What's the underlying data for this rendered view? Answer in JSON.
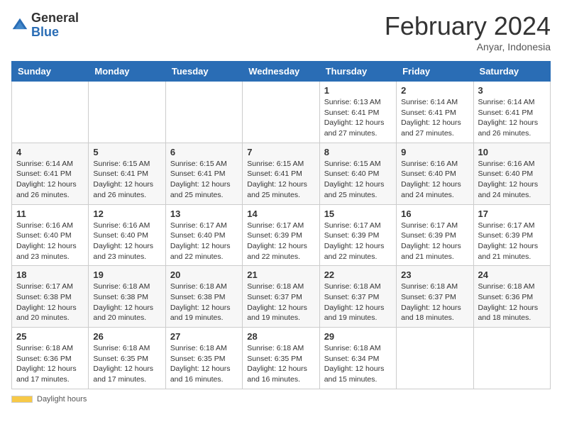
{
  "header": {
    "logo_general": "General",
    "logo_blue": "Blue",
    "month_title": "February 2024",
    "location": "Anyar, Indonesia"
  },
  "days_of_week": [
    "Sunday",
    "Monday",
    "Tuesday",
    "Wednesday",
    "Thursday",
    "Friday",
    "Saturday"
  ],
  "footer": {
    "daylight_label": "Daylight hours"
  },
  "weeks": [
    [
      {
        "day": "",
        "info": ""
      },
      {
        "day": "",
        "info": ""
      },
      {
        "day": "",
        "info": ""
      },
      {
        "day": "",
        "info": ""
      },
      {
        "day": "1",
        "info": "Sunrise: 6:13 AM\nSunset: 6:41 PM\nDaylight: 12 hours and 27 minutes."
      },
      {
        "day": "2",
        "info": "Sunrise: 6:14 AM\nSunset: 6:41 PM\nDaylight: 12 hours and 27 minutes."
      },
      {
        "day": "3",
        "info": "Sunrise: 6:14 AM\nSunset: 6:41 PM\nDaylight: 12 hours and 26 minutes."
      }
    ],
    [
      {
        "day": "4",
        "info": "Sunrise: 6:14 AM\nSunset: 6:41 PM\nDaylight: 12 hours and 26 minutes."
      },
      {
        "day": "5",
        "info": "Sunrise: 6:15 AM\nSunset: 6:41 PM\nDaylight: 12 hours and 26 minutes."
      },
      {
        "day": "6",
        "info": "Sunrise: 6:15 AM\nSunset: 6:41 PM\nDaylight: 12 hours and 25 minutes."
      },
      {
        "day": "7",
        "info": "Sunrise: 6:15 AM\nSunset: 6:41 PM\nDaylight: 12 hours and 25 minutes."
      },
      {
        "day": "8",
        "info": "Sunrise: 6:15 AM\nSunset: 6:40 PM\nDaylight: 12 hours and 25 minutes."
      },
      {
        "day": "9",
        "info": "Sunrise: 6:16 AM\nSunset: 6:40 PM\nDaylight: 12 hours and 24 minutes."
      },
      {
        "day": "10",
        "info": "Sunrise: 6:16 AM\nSunset: 6:40 PM\nDaylight: 12 hours and 24 minutes."
      }
    ],
    [
      {
        "day": "11",
        "info": "Sunrise: 6:16 AM\nSunset: 6:40 PM\nDaylight: 12 hours and 23 minutes."
      },
      {
        "day": "12",
        "info": "Sunrise: 6:16 AM\nSunset: 6:40 PM\nDaylight: 12 hours and 23 minutes."
      },
      {
        "day": "13",
        "info": "Sunrise: 6:17 AM\nSunset: 6:40 PM\nDaylight: 12 hours and 22 minutes."
      },
      {
        "day": "14",
        "info": "Sunrise: 6:17 AM\nSunset: 6:39 PM\nDaylight: 12 hours and 22 minutes."
      },
      {
        "day": "15",
        "info": "Sunrise: 6:17 AM\nSunset: 6:39 PM\nDaylight: 12 hours and 22 minutes."
      },
      {
        "day": "16",
        "info": "Sunrise: 6:17 AM\nSunset: 6:39 PM\nDaylight: 12 hours and 21 minutes."
      },
      {
        "day": "17",
        "info": "Sunrise: 6:17 AM\nSunset: 6:39 PM\nDaylight: 12 hours and 21 minutes."
      }
    ],
    [
      {
        "day": "18",
        "info": "Sunrise: 6:17 AM\nSunset: 6:38 PM\nDaylight: 12 hours and 20 minutes."
      },
      {
        "day": "19",
        "info": "Sunrise: 6:18 AM\nSunset: 6:38 PM\nDaylight: 12 hours and 20 minutes."
      },
      {
        "day": "20",
        "info": "Sunrise: 6:18 AM\nSunset: 6:38 PM\nDaylight: 12 hours and 19 minutes."
      },
      {
        "day": "21",
        "info": "Sunrise: 6:18 AM\nSunset: 6:37 PM\nDaylight: 12 hours and 19 minutes."
      },
      {
        "day": "22",
        "info": "Sunrise: 6:18 AM\nSunset: 6:37 PM\nDaylight: 12 hours and 19 minutes."
      },
      {
        "day": "23",
        "info": "Sunrise: 6:18 AM\nSunset: 6:37 PM\nDaylight: 12 hours and 18 minutes."
      },
      {
        "day": "24",
        "info": "Sunrise: 6:18 AM\nSunset: 6:36 PM\nDaylight: 12 hours and 18 minutes."
      }
    ],
    [
      {
        "day": "25",
        "info": "Sunrise: 6:18 AM\nSunset: 6:36 PM\nDaylight: 12 hours and 17 minutes."
      },
      {
        "day": "26",
        "info": "Sunrise: 6:18 AM\nSunset: 6:35 PM\nDaylight: 12 hours and 17 minutes."
      },
      {
        "day": "27",
        "info": "Sunrise: 6:18 AM\nSunset: 6:35 PM\nDaylight: 12 hours and 16 minutes."
      },
      {
        "day": "28",
        "info": "Sunrise: 6:18 AM\nSunset: 6:35 PM\nDaylight: 12 hours and 16 minutes."
      },
      {
        "day": "29",
        "info": "Sunrise: 6:18 AM\nSunset: 6:34 PM\nDaylight: 12 hours and 15 minutes."
      },
      {
        "day": "",
        "info": ""
      },
      {
        "day": "",
        "info": ""
      }
    ]
  ]
}
